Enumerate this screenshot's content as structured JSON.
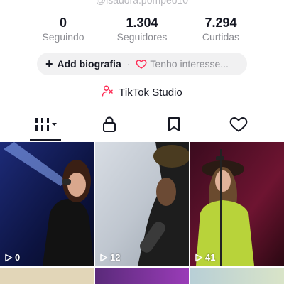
{
  "profile": {
    "handle": "@isadora.pompeo10"
  },
  "stats": [
    {
      "value": "0",
      "label": "Seguindo"
    },
    {
      "value": "1.304",
      "label": "Seguidores"
    },
    {
      "value": "7.294",
      "label": "Curtidas"
    }
  ],
  "bio": {
    "add_label": "Add biografia",
    "separator": "·",
    "interest_label": "Tenho interesse..."
  },
  "studio": {
    "label": "TikTok Studio"
  },
  "tabs": [
    {
      "icon": "videos-grid-icon",
      "selected": true
    },
    {
      "icon": "lock-icon",
      "selected": false
    },
    {
      "icon": "bookmark-icon",
      "selected": false
    },
    {
      "icon": "heart-icon",
      "selected": false
    }
  ],
  "videos": [
    {
      "views": "0"
    },
    {
      "views": "12"
    },
    {
      "views": "41"
    }
  ],
  "colors": {
    "accent": "#fe2c55",
    "text": "#161823",
    "muted": "#8a8b91",
    "pill": "#f1f1f2"
  }
}
